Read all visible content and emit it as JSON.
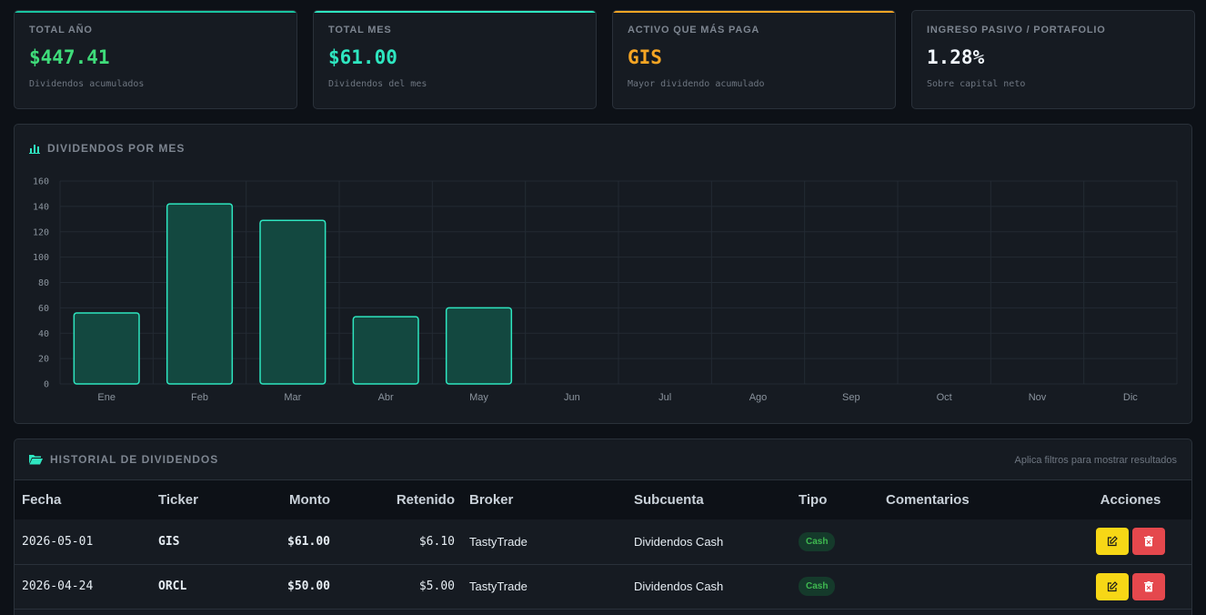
{
  "cards": [
    {
      "label": "TOTAL AÑO",
      "value": "$447.41",
      "sub": "Dividendos acumulados",
      "color": "#3fdc7a",
      "accent": "#19c4a0"
    },
    {
      "label": "TOTAL MES",
      "value": "$61.00",
      "sub": "Dividendos del mes",
      "color": "#2ee6c0",
      "accent": "#2ee6c0"
    },
    {
      "label": "ACTIVO QUE MÁS PAGA",
      "value": "GIS",
      "sub": "Mayor dividendo acumulado",
      "color": "#f5a524",
      "accent": "#f5a524"
    },
    {
      "label": "INGRESO PASIVO / PORTAFOLIO",
      "value": "1.28%",
      "sub": "Sobre capital neto",
      "color": "#f0f6fc",
      "accent": "#2a313a"
    }
  ],
  "chart": {
    "title": "DIVIDENDOS POR MES",
    "icon": "bar-chart-icon"
  },
  "chart_data": {
    "type": "bar",
    "title": "DIVIDENDOS POR MES",
    "categories": [
      "Ene",
      "Feb",
      "Mar",
      "Abr",
      "May",
      "Jun",
      "Jul",
      "Ago",
      "Sep",
      "Oct",
      "Nov",
      "Dic"
    ],
    "values": [
      56,
      142,
      129,
      53,
      60,
      0,
      0,
      0,
      0,
      0,
      0,
      0
    ],
    "yticks": [
      0,
      20,
      40,
      60,
      80,
      100,
      120,
      140,
      160
    ],
    "ylim": [
      0,
      160
    ],
    "xlabel": "",
    "ylabel": "",
    "grid": true,
    "bar_fill": "#134840",
    "bar_stroke": "#2ee6c0"
  },
  "history": {
    "title": "HISTORIAL DE DIVIDENDOS",
    "icon": "folder-open-icon",
    "hint": "Aplica filtros para mostrar resultados",
    "columns": [
      "Fecha",
      "Ticker",
      "Monto",
      "Retenido",
      "Broker",
      "Subcuenta",
      "Tipo",
      "Comentarios",
      "Acciones"
    ],
    "rows": [
      {
        "fecha": "2026-05-01",
        "ticker": "GIS",
        "monto": "$61.00",
        "retenido": "$6.10",
        "broker": "TastyTrade",
        "subcuenta": "Dividendos Cash",
        "tipo": "Cash",
        "comentarios": ""
      },
      {
        "fecha": "2026-04-24",
        "ticker": "ORCL",
        "monto": "$50.00",
        "retenido": "$5.00",
        "broker": "TastyTrade",
        "subcuenta": "Dividendos Cash",
        "tipo": "Cash",
        "comentarios": ""
      }
    ]
  }
}
